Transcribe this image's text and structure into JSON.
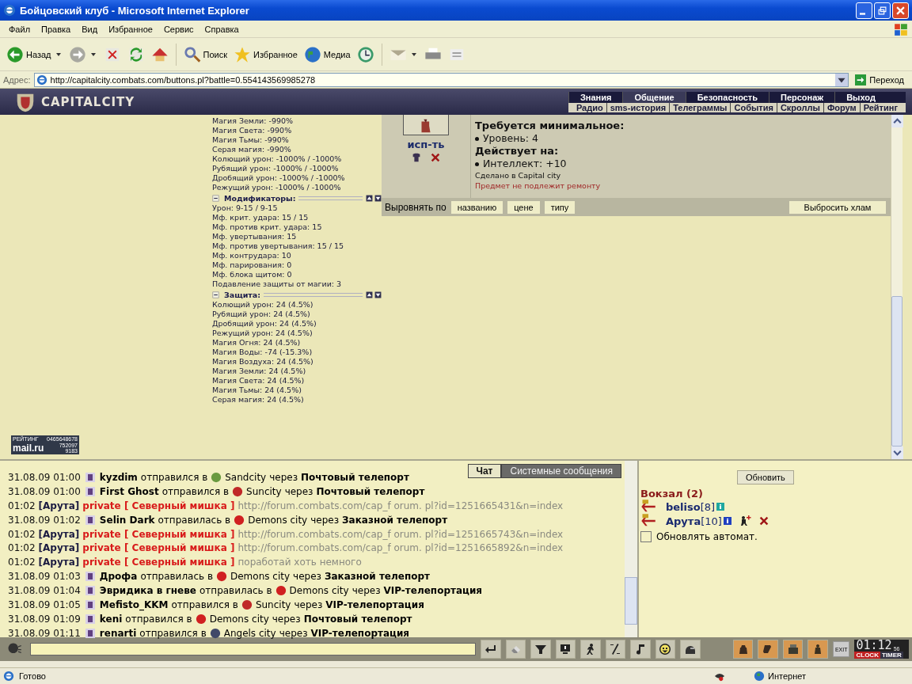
{
  "window": {
    "title": "Бойцовский клуб - Microsoft Internet Explorer"
  },
  "menu": [
    "Файл",
    "Правка",
    "Вид",
    "Избранное",
    "Сервис",
    "Справка"
  ],
  "toolbar": [
    {
      "kind": "back",
      "label": "Назад",
      "dropdown": true
    },
    {
      "kind": "forward",
      "dropdown": true
    },
    {
      "kind": "stop"
    },
    {
      "kind": "refresh"
    },
    {
      "kind": "home"
    },
    {
      "kind": "search",
      "label": "Поиск"
    },
    {
      "kind": "star",
      "label": "Избранное"
    },
    {
      "kind": "globe",
      "label": "Медиа"
    },
    {
      "kind": "history"
    },
    {
      "kind": "mail",
      "dropdown": true
    },
    {
      "kind": "printer"
    },
    {
      "kind": "edit"
    }
  ],
  "address": {
    "label": "Адрес:",
    "value": "http://capitalcity.combats.com/buttons.pl?battle=0.554143569985278",
    "go": "Переход"
  },
  "game_header": {
    "logo": "CAPITALCITY",
    "nav_top": [
      {
        "label": "Знания",
        "selected": false
      },
      {
        "label": "Общение",
        "selected": true
      },
      {
        "label": "Безопасность",
        "selected": false
      },
      {
        "label": "Персонаж",
        "selected": false
      },
      {
        "label": "Выход",
        "selected": false
      }
    ],
    "nav_bottom": [
      "Радио",
      "sms-история",
      "Телеграммы",
      "События",
      "Скроллы",
      "Форум",
      "Рейтинг"
    ]
  },
  "counter": {
    "label": "РЕЙТИНГ",
    "number": "0465648678",
    "brand": "mail.ru",
    "hits": "752097",
    "hosts": "9183"
  },
  "stats": [
    {
      "lines": [
        "Магия Земли: -990%",
        "Магия Света: -990%",
        "Магия Тьмы: -990%",
        "Серая магия: -990%",
        "Колющий урон: -1000% / -1000%",
        "Рубящий урон: -1000% / -1000%",
        "Дробящий урон: -1000% / -1000%",
        "Режущий урон: -1000% / -1000%"
      ]
    },
    {
      "title": "Модификаторы:",
      "lines": [
        "Урон: 9-15 / 9-15",
        "Мф. крит. удара: 15 / 15",
        "Мф. против крит. удара: 15",
        "Мф. увертывания: 15",
        "Мф. против увертывания: 15 / 15",
        "Мф. контрудара: 10",
        "Мф. парирования: 0",
        "Мф. блока щитом: 0",
        "Подавление защиты от магии: 3"
      ]
    },
    {
      "title": "Защита:",
      "lines": [
        "Колющий урон: 24 (4.5%)",
        "Рубящий урон: 24 (4.5%)",
        "Дробящий урон: 24 (4.5%)",
        "Режущий урон: 24 (4.5%)",
        "Магия Огня: 24 (4.5%)",
        "Магия Воды: -74 (-15.3%)",
        "Магия Воздуха: 24 (4.5%)",
        "Магия Земли: 24 (4.5%)",
        "Магия Света: 24 (4.5%)",
        "Магия Тьмы: 24 (4.5%)",
        "Серая магия: 24 (4.5%)"
      ]
    }
  ],
  "item": {
    "use": "исп-ть",
    "details": [
      {
        "kind": "heading",
        "text": "Требуется минимальное:"
      },
      {
        "kind": "bullet",
        "text": "Уровень: 4"
      },
      {
        "kind": "heading",
        "text": "Действует на:"
      },
      {
        "kind": "bullet",
        "text": "Интеллект: +10"
      },
      {
        "kind": "note",
        "text": "Сделано в Capital city"
      },
      {
        "kind": "warning",
        "text": "Предмет не подлежит ремонту"
      }
    ]
  },
  "sort_bar": {
    "label": "Выровнять по",
    "buttons": [
      "названию",
      "цене",
      "типу"
    ],
    "discard": "Выбросить хлам"
  },
  "chat": {
    "tabs": [
      {
        "label": "Чат",
        "selected": true
      },
      {
        "label": "Системные сообщения",
        "selected": false
      }
    ],
    "messages": [
      {
        "kind": "travel",
        "time": "31.08.09 01:00",
        "name": "kyzdim",
        "verb": "отправился в",
        "city": "Sandcity",
        "color": "#6a9a40",
        "via": "через",
        "method": "Почтовый телепорт"
      },
      {
        "kind": "travel",
        "time": "31.08.09 01:00",
        "name": "First Ghost",
        "verb": "отправился в",
        "city": "Suncity",
        "color": "#c02828",
        "via": "через",
        "method": "Почтовый телепорт"
      },
      {
        "kind": "private",
        "time": "01:02",
        "sender": "[Арута]",
        "target": "private [ Северный мишка ]",
        "text": "http://forum.combats.com/cap_f orum. pl?id=1251665431&n=index"
      },
      {
        "kind": "travel",
        "time": "31.08.09 01:02",
        "name": "Selin Dark",
        "verb": "отправилась в",
        "city": "Demons city",
        "color": "#d02020",
        "via": "через",
        "method": "Заказной телепорт"
      },
      {
        "kind": "private",
        "time": "01:02",
        "sender": "[Арута]",
        "target": "private [ Северный мишка ]",
        "text": "http://forum.combats.com/cap_f orum. pl?id=1251665743&n=index"
      },
      {
        "kind": "private",
        "time": "01:02",
        "sender": "[Арута]",
        "target": "private [ Северный мишка ]",
        "text": "http://forum.combats.com/cap_f orum. pl?id=1251665892&n=index"
      },
      {
        "kind": "private",
        "time": "01:02",
        "sender": "[Арута]",
        "target": "private [ Северный мишка ]",
        "text": "поработай хоть немного"
      },
      {
        "kind": "travel",
        "time": "31.08.09 01:03",
        "name": "Дрофа",
        "verb": "отправилась в",
        "city": "Demons city",
        "color": "#d02020",
        "via": "через",
        "method": "Заказной телепорт"
      },
      {
        "kind": "travel",
        "time": "31.08.09 01:04",
        "name": "Эвридика в гневе",
        "verb": "отправилась в",
        "city": "Demons city",
        "color": "#d02020",
        "via": "через",
        "method": "VIP-телепортация"
      },
      {
        "kind": "travel",
        "time": "31.08.09 01:05",
        "name": "Mefisto_KKM",
        "verb": "отправился в",
        "city": "Suncity",
        "color": "#c02828",
        "via": "через",
        "method": "VIP-телепортация"
      },
      {
        "kind": "travel",
        "time": "31.08.09 01:09",
        "name": "keni",
        "verb": "отправился в",
        "city": "Demons city",
        "color": "#d02020",
        "via": "через",
        "method": "Почтовый телепорт"
      },
      {
        "kind": "travel",
        "time": "31.08.09 01:11",
        "name": "renarti",
        "verb": "отправился в",
        "city": "Angels city",
        "color": "#404868",
        "via": "через",
        "method": "VIP-телепортация"
      }
    ]
  },
  "room": {
    "refresh": "Обновить",
    "title": "Вокзал (2)",
    "users": [
      {
        "name": "beliso",
        "level": "[8]",
        "color": "#20a8a0",
        "actions": false
      },
      {
        "name": "Арута",
        "level": "[10]",
        "color": "#2040c0",
        "actions": true
      }
    ],
    "auto_refresh": {
      "label": "Обновлять автомат.",
      "checked": false
    }
  },
  "bottom_bar": {
    "exit": "EXIT",
    "clock": "01:12",
    "seconds": "56",
    "clock_label": "CLOCK",
    "timer_label": "TIMER"
  },
  "status_bar": {
    "text": "Готово",
    "zone": "Интернет"
  }
}
